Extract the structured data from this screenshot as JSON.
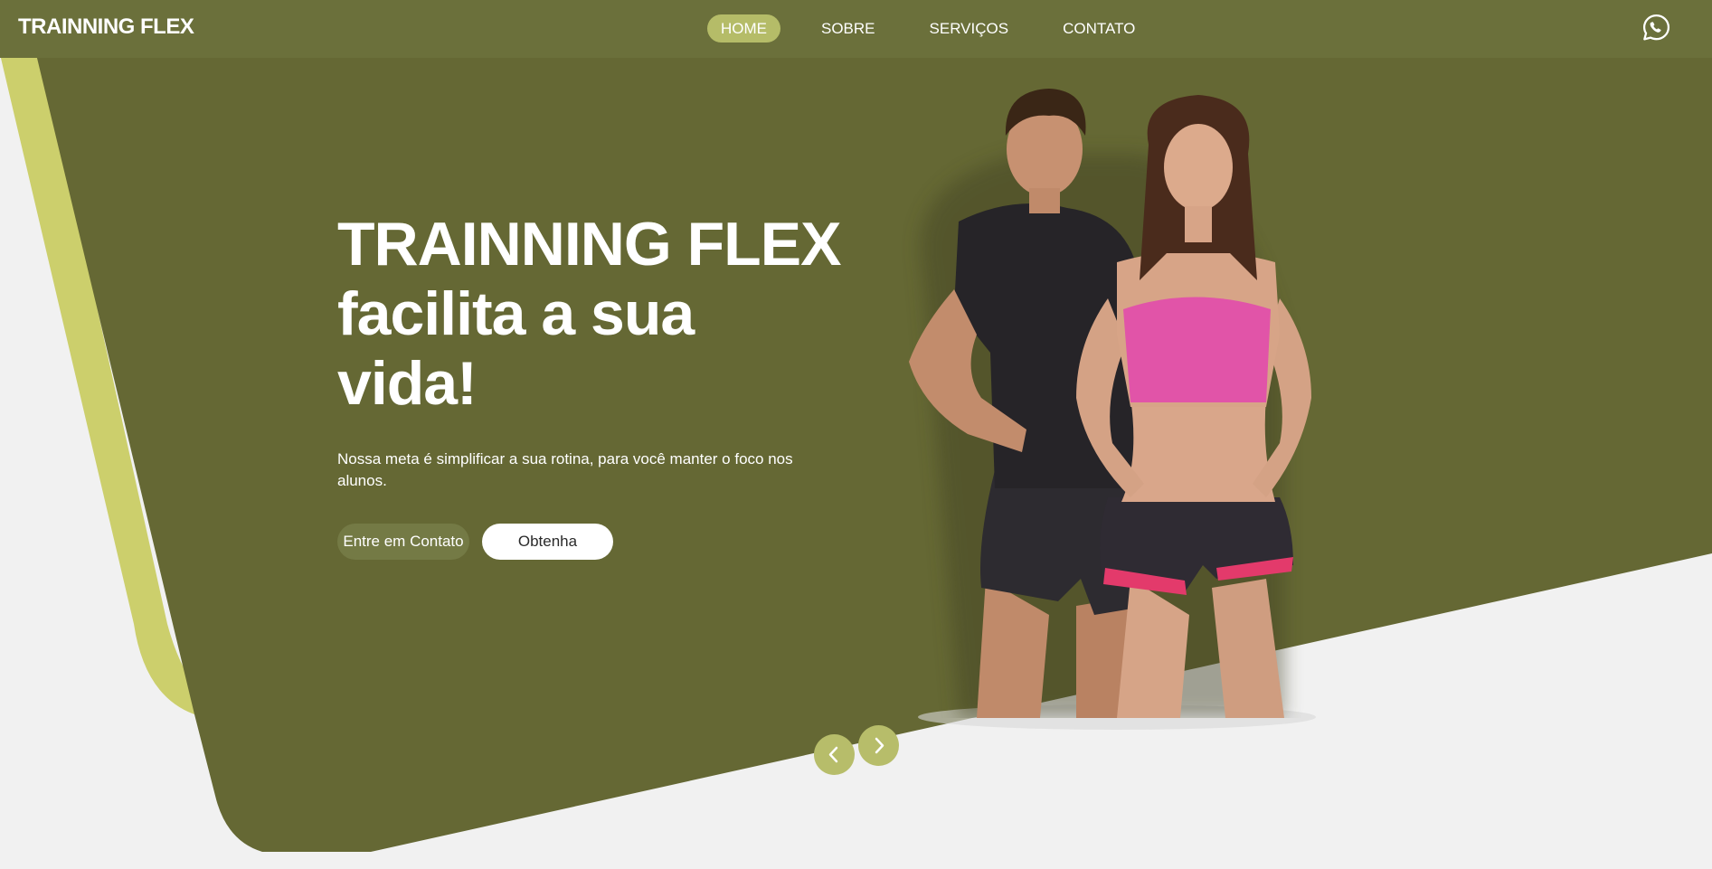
{
  "header": {
    "brand": "TRAINNING FLEX",
    "nav": [
      {
        "label": "HOME",
        "active": true
      },
      {
        "label": "SOBRE",
        "active": false
      },
      {
        "label": "SERVIÇOS",
        "active": false
      },
      {
        "label": "CONTATO",
        "active": false
      }
    ],
    "contact_icon": "whatsapp-icon"
  },
  "hero": {
    "title_line1": "TRAINNING FLEX",
    "title_line2": "facilita a sua",
    "title_line3": "vida!",
    "subtitle": "Nossa meta é simplificar a sua rotina, para você manter o foco nos alunos.",
    "primary_button": "Entre em Contato",
    "secondary_button": "Obtenha"
  },
  "carousel": {
    "prev_icon": "chevron-left-icon",
    "next_icon": "chevron-right-icon"
  },
  "colors": {
    "header_bg": "#6b703b",
    "hero_bg": "#656834",
    "accent_lime": "#cccf6c",
    "nav_active": "#b5bc68",
    "page_bg": "#f1f1f1"
  }
}
